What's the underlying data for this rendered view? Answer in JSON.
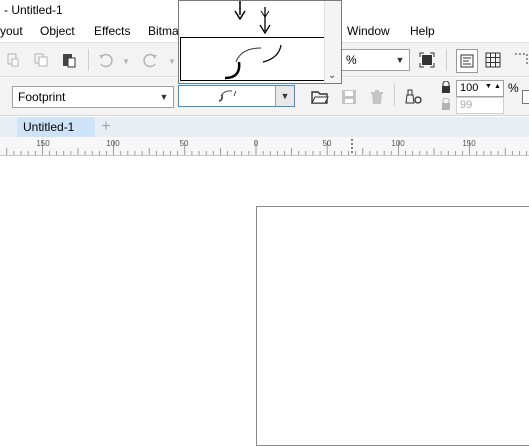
{
  "window": {
    "title": "- Untitled-1"
  },
  "menu": {
    "items": [
      "yout",
      "Object",
      "Effects",
      "Bitma",
      "Window",
      "Help"
    ]
  },
  "toolbar": {
    "zoom_value": "%"
  },
  "propbar": {
    "preset_value": "Footprint",
    "opacity_value": "100",
    "opacity2_value": "99",
    "percent_label": "%"
  },
  "tabs": {
    "doc_tab": "Untitled-1",
    "add_tab": "+"
  },
  "ruler": {
    "labels": [
      "150",
      "100",
      "50",
      "0",
      "50",
      "100",
      "150"
    ]
  },
  "icons": {
    "paste_special": "paste-special-icon",
    "copy": "copy-icon",
    "paste": "paste-icon",
    "undo": "undo-icon",
    "redo": "redo-icon",
    "full_screen": "full-screen-icon",
    "options": "options-icon",
    "grid": "grid-icon",
    "open": "open-folder-icon",
    "save": "save-icon",
    "delete": "delete-icon"
  }
}
